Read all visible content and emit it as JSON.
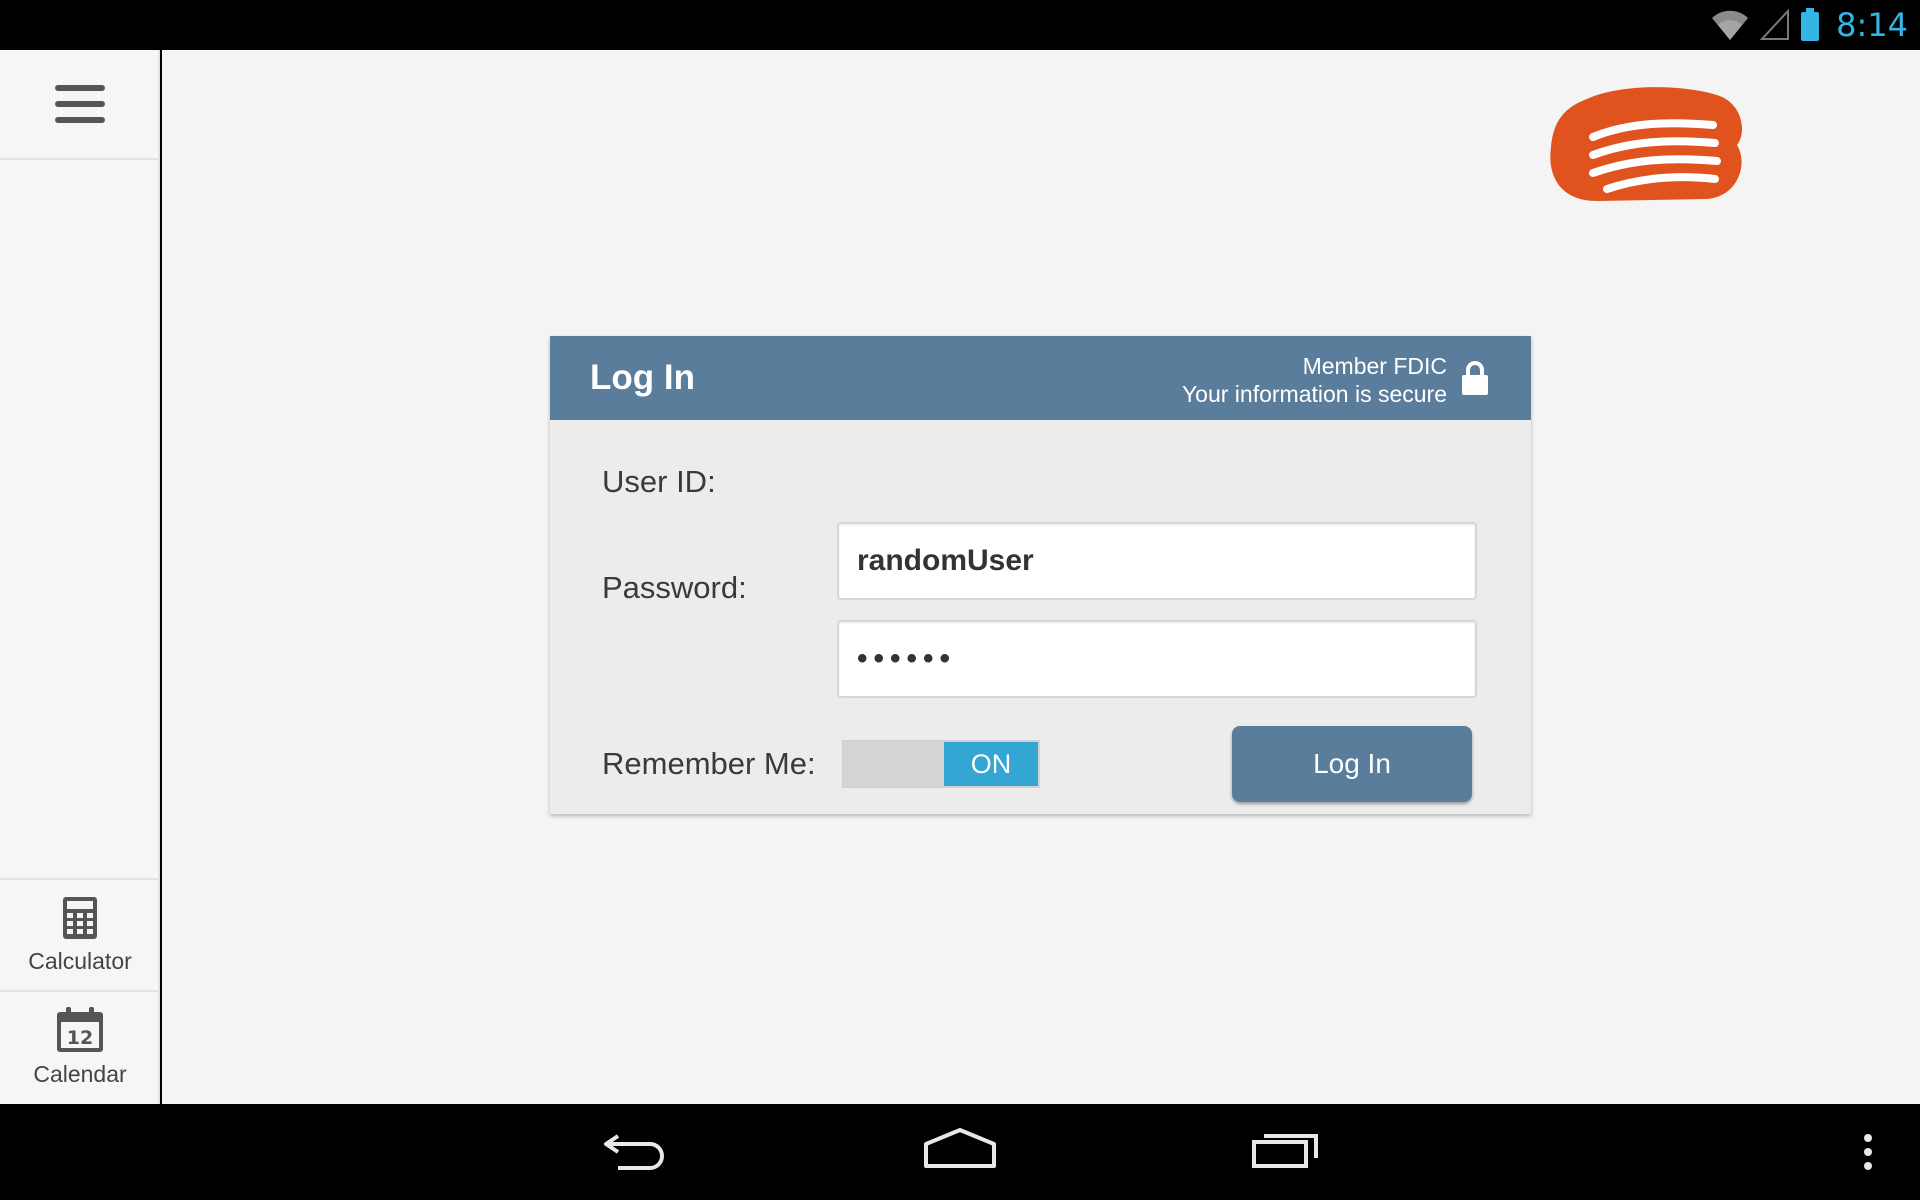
{
  "status_bar": {
    "time": "8:14",
    "icons": [
      "wifi-icon",
      "cell-signal-icon",
      "battery-icon"
    ],
    "accent_color": "#33b5e5"
  },
  "sidebar": {
    "menu_icon": "hamburger-menu-icon",
    "tools": [
      {
        "label": "Calculator",
        "icon": "calculator-icon"
      },
      {
        "label": "Calendar",
        "icon": "calendar-icon",
        "icon_text": "12"
      }
    ]
  },
  "brand": {
    "logo_icon": "bank-logo-icon",
    "color": "#e0531f"
  },
  "login": {
    "title": "Log In",
    "secure_line1": "Member FDIC",
    "secure_line2": "Your information is secure",
    "header_color": "#5b7d9c",
    "user_label": "User ID:",
    "user_value": "randomUser",
    "password_label": "Password:",
    "password_value": "••••••",
    "remember_label": "Remember Me:",
    "remember_state": "ON",
    "button_label": "Log In"
  },
  "nav_bar": {
    "buttons": [
      "back-icon",
      "home-icon",
      "recent-apps-icon",
      "overflow-menu-icon"
    ]
  }
}
